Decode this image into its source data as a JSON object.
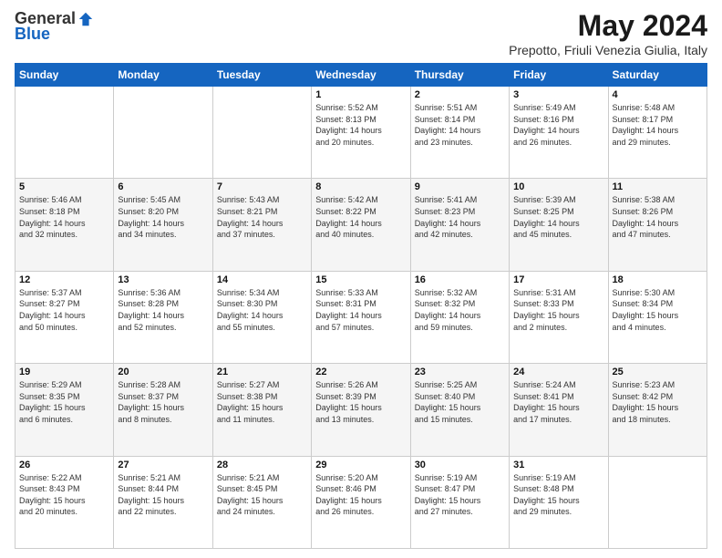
{
  "header": {
    "logo_general": "General",
    "logo_blue": "Blue",
    "main_title": "May 2024",
    "subtitle": "Prepotto, Friuli Venezia Giulia, Italy"
  },
  "days_of_week": [
    "Sunday",
    "Monday",
    "Tuesday",
    "Wednesday",
    "Thursday",
    "Friday",
    "Saturday"
  ],
  "weeks": [
    [
      {
        "day": "",
        "info": ""
      },
      {
        "day": "",
        "info": ""
      },
      {
        "day": "",
        "info": ""
      },
      {
        "day": "1",
        "info": "Sunrise: 5:52 AM\nSunset: 8:13 PM\nDaylight: 14 hours\nand 20 minutes."
      },
      {
        "day": "2",
        "info": "Sunrise: 5:51 AM\nSunset: 8:14 PM\nDaylight: 14 hours\nand 23 minutes."
      },
      {
        "day": "3",
        "info": "Sunrise: 5:49 AM\nSunset: 8:16 PM\nDaylight: 14 hours\nand 26 minutes."
      },
      {
        "day": "4",
        "info": "Sunrise: 5:48 AM\nSunset: 8:17 PM\nDaylight: 14 hours\nand 29 minutes."
      }
    ],
    [
      {
        "day": "5",
        "info": "Sunrise: 5:46 AM\nSunset: 8:18 PM\nDaylight: 14 hours\nand 32 minutes."
      },
      {
        "day": "6",
        "info": "Sunrise: 5:45 AM\nSunset: 8:20 PM\nDaylight: 14 hours\nand 34 minutes."
      },
      {
        "day": "7",
        "info": "Sunrise: 5:43 AM\nSunset: 8:21 PM\nDaylight: 14 hours\nand 37 minutes."
      },
      {
        "day": "8",
        "info": "Sunrise: 5:42 AM\nSunset: 8:22 PM\nDaylight: 14 hours\nand 40 minutes."
      },
      {
        "day": "9",
        "info": "Sunrise: 5:41 AM\nSunset: 8:23 PM\nDaylight: 14 hours\nand 42 minutes."
      },
      {
        "day": "10",
        "info": "Sunrise: 5:39 AM\nSunset: 8:25 PM\nDaylight: 14 hours\nand 45 minutes."
      },
      {
        "day": "11",
        "info": "Sunrise: 5:38 AM\nSunset: 8:26 PM\nDaylight: 14 hours\nand 47 minutes."
      }
    ],
    [
      {
        "day": "12",
        "info": "Sunrise: 5:37 AM\nSunset: 8:27 PM\nDaylight: 14 hours\nand 50 minutes."
      },
      {
        "day": "13",
        "info": "Sunrise: 5:36 AM\nSunset: 8:28 PM\nDaylight: 14 hours\nand 52 minutes."
      },
      {
        "day": "14",
        "info": "Sunrise: 5:34 AM\nSunset: 8:30 PM\nDaylight: 14 hours\nand 55 minutes."
      },
      {
        "day": "15",
        "info": "Sunrise: 5:33 AM\nSunset: 8:31 PM\nDaylight: 14 hours\nand 57 minutes."
      },
      {
        "day": "16",
        "info": "Sunrise: 5:32 AM\nSunset: 8:32 PM\nDaylight: 14 hours\nand 59 minutes."
      },
      {
        "day": "17",
        "info": "Sunrise: 5:31 AM\nSunset: 8:33 PM\nDaylight: 15 hours\nand 2 minutes."
      },
      {
        "day": "18",
        "info": "Sunrise: 5:30 AM\nSunset: 8:34 PM\nDaylight: 15 hours\nand 4 minutes."
      }
    ],
    [
      {
        "day": "19",
        "info": "Sunrise: 5:29 AM\nSunset: 8:35 PM\nDaylight: 15 hours\nand 6 minutes."
      },
      {
        "day": "20",
        "info": "Sunrise: 5:28 AM\nSunset: 8:37 PM\nDaylight: 15 hours\nand 8 minutes."
      },
      {
        "day": "21",
        "info": "Sunrise: 5:27 AM\nSunset: 8:38 PM\nDaylight: 15 hours\nand 11 minutes."
      },
      {
        "day": "22",
        "info": "Sunrise: 5:26 AM\nSunset: 8:39 PM\nDaylight: 15 hours\nand 13 minutes."
      },
      {
        "day": "23",
        "info": "Sunrise: 5:25 AM\nSunset: 8:40 PM\nDaylight: 15 hours\nand 15 minutes."
      },
      {
        "day": "24",
        "info": "Sunrise: 5:24 AM\nSunset: 8:41 PM\nDaylight: 15 hours\nand 17 minutes."
      },
      {
        "day": "25",
        "info": "Sunrise: 5:23 AM\nSunset: 8:42 PM\nDaylight: 15 hours\nand 18 minutes."
      }
    ],
    [
      {
        "day": "26",
        "info": "Sunrise: 5:22 AM\nSunset: 8:43 PM\nDaylight: 15 hours\nand 20 minutes."
      },
      {
        "day": "27",
        "info": "Sunrise: 5:21 AM\nSunset: 8:44 PM\nDaylight: 15 hours\nand 22 minutes."
      },
      {
        "day": "28",
        "info": "Sunrise: 5:21 AM\nSunset: 8:45 PM\nDaylight: 15 hours\nand 24 minutes."
      },
      {
        "day": "29",
        "info": "Sunrise: 5:20 AM\nSunset: 8:46 PM\nDaylight: 15 hours\nand 26 minutes."
      },
      {
        "day": "30",
        "info": "Sunrise: 5:19 AM\nSunset: 8:47 PM\nDaylight: 15 hours\nand 27 minutes."
      },
      {
        "day": "31",
        "info": "Sunrise: 5:19 AM\nSunset: 8:48 PM\nDaylight: 15 hours\nand 29 minutes."
      },
      {
        "day": "",
        "info": ""
      }
    ]
  ]
}
